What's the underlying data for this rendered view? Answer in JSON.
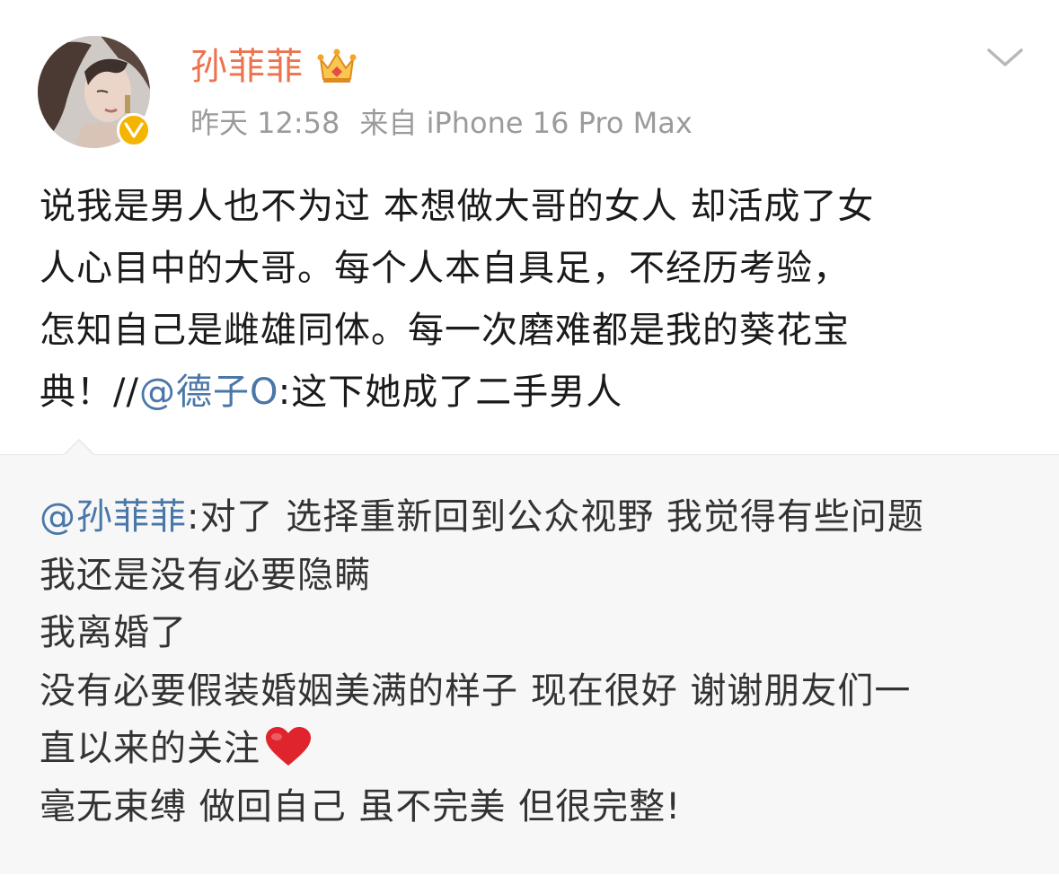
{
  "post": {
    "username": "孙菲菲",
    "timestamp": "昨天 12:58",
    "source": "来自 iPhone 16 Pro Max",
    "lines": [
      "说我是男人也不为过 本想做大哥的女人 却活成了女",
      "人心目中的大哥。每个人本自具足，不经历考验，",
      "怎知自己是雌雄同体。每一次磨难都是我的葵花宝"
    ],
    "last_line_prefix": "典！//",
    "mention": "@德子O",
    "last_line_suffix": ":这下她成了二手男人"
  },
  "retweet": {
    "mention": "@孙菲菲",
    "first_line_suffix": ":对了 选择重新回到公众视野 我觉得有些问题",
    "line2": "我还是没有必要隐瞒",
    "line3": "我离婚了",
    "line4": "没有必要假装婚姻美满的样子 现在很好 谢谢朋友们一",
    "line5": "直以来的关注",
    "line6": "毫无束缚 做回自己 虽不完美 但很完整!"
  },
  "icons": {
    "verified": "verified-v-badge-icon",
    "crown": "crown-icon",
    "menu": "chevron-down-icon",
    "heart": "red-heart-icon"
  },
  "colors": {
    "username": "#eb7350",
    "mention": "#4a76a8",
    "meta": "#9b9b9b",
    "retweet_bg": "#f7f7f7",
    "badge": "#f4b400"
  }
}
